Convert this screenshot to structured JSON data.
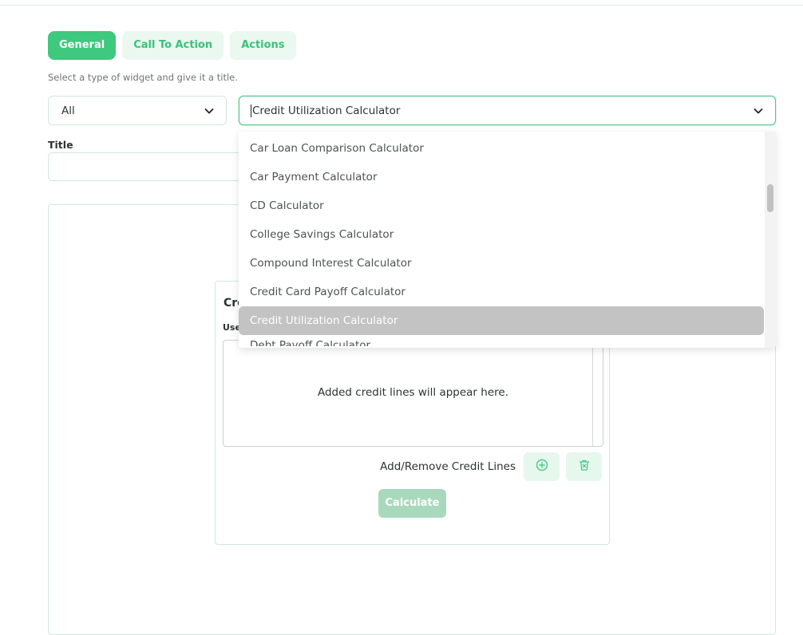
{
  "tabs": [
    {
      "label": "General",
      "active": true
    },
    {
      "label": "Call To Action",
      "active": false
    },
    {
      "label": "Actions",
      "active": false
    }
  ],
  "hint": "Select a type of widget and give it a title.",
  "type_select": {
    "value": "All"
  },
  "widget_select": {
    "value": "Credit Utilization Calculator"
  },
  "title_field": {
    "label": "Title",
    "value": ""
  },
  "dropdown": {
    "options": [
      "Car Loan Comparison Calculator",
      "Car Payment Calculator",
      "CD Calculator",
      "College Savings Calculator",
      "Compound Interest Calculator",
      "Credit Card Payoff Calculator",
      "Credit Utilization Calculator",
      "Debt Payoff Calculator"
    ],
    "selected": "Credit Utilization Calculator"
  },
  "preview": {
    "card_title": "Cre",
    "card_subtitle": "Use",
    "empty_text": "Added credit lines will appear here.",
    "lines_label": "Add/Remove Credit Lines",
    "calculate_label": "Calculate"
  },
  "colors": {
    "accent": "#3ec97e",
    "accent_light": "#eaf8f0",
    "selected_option": "#c3c3c3"
  }
}
